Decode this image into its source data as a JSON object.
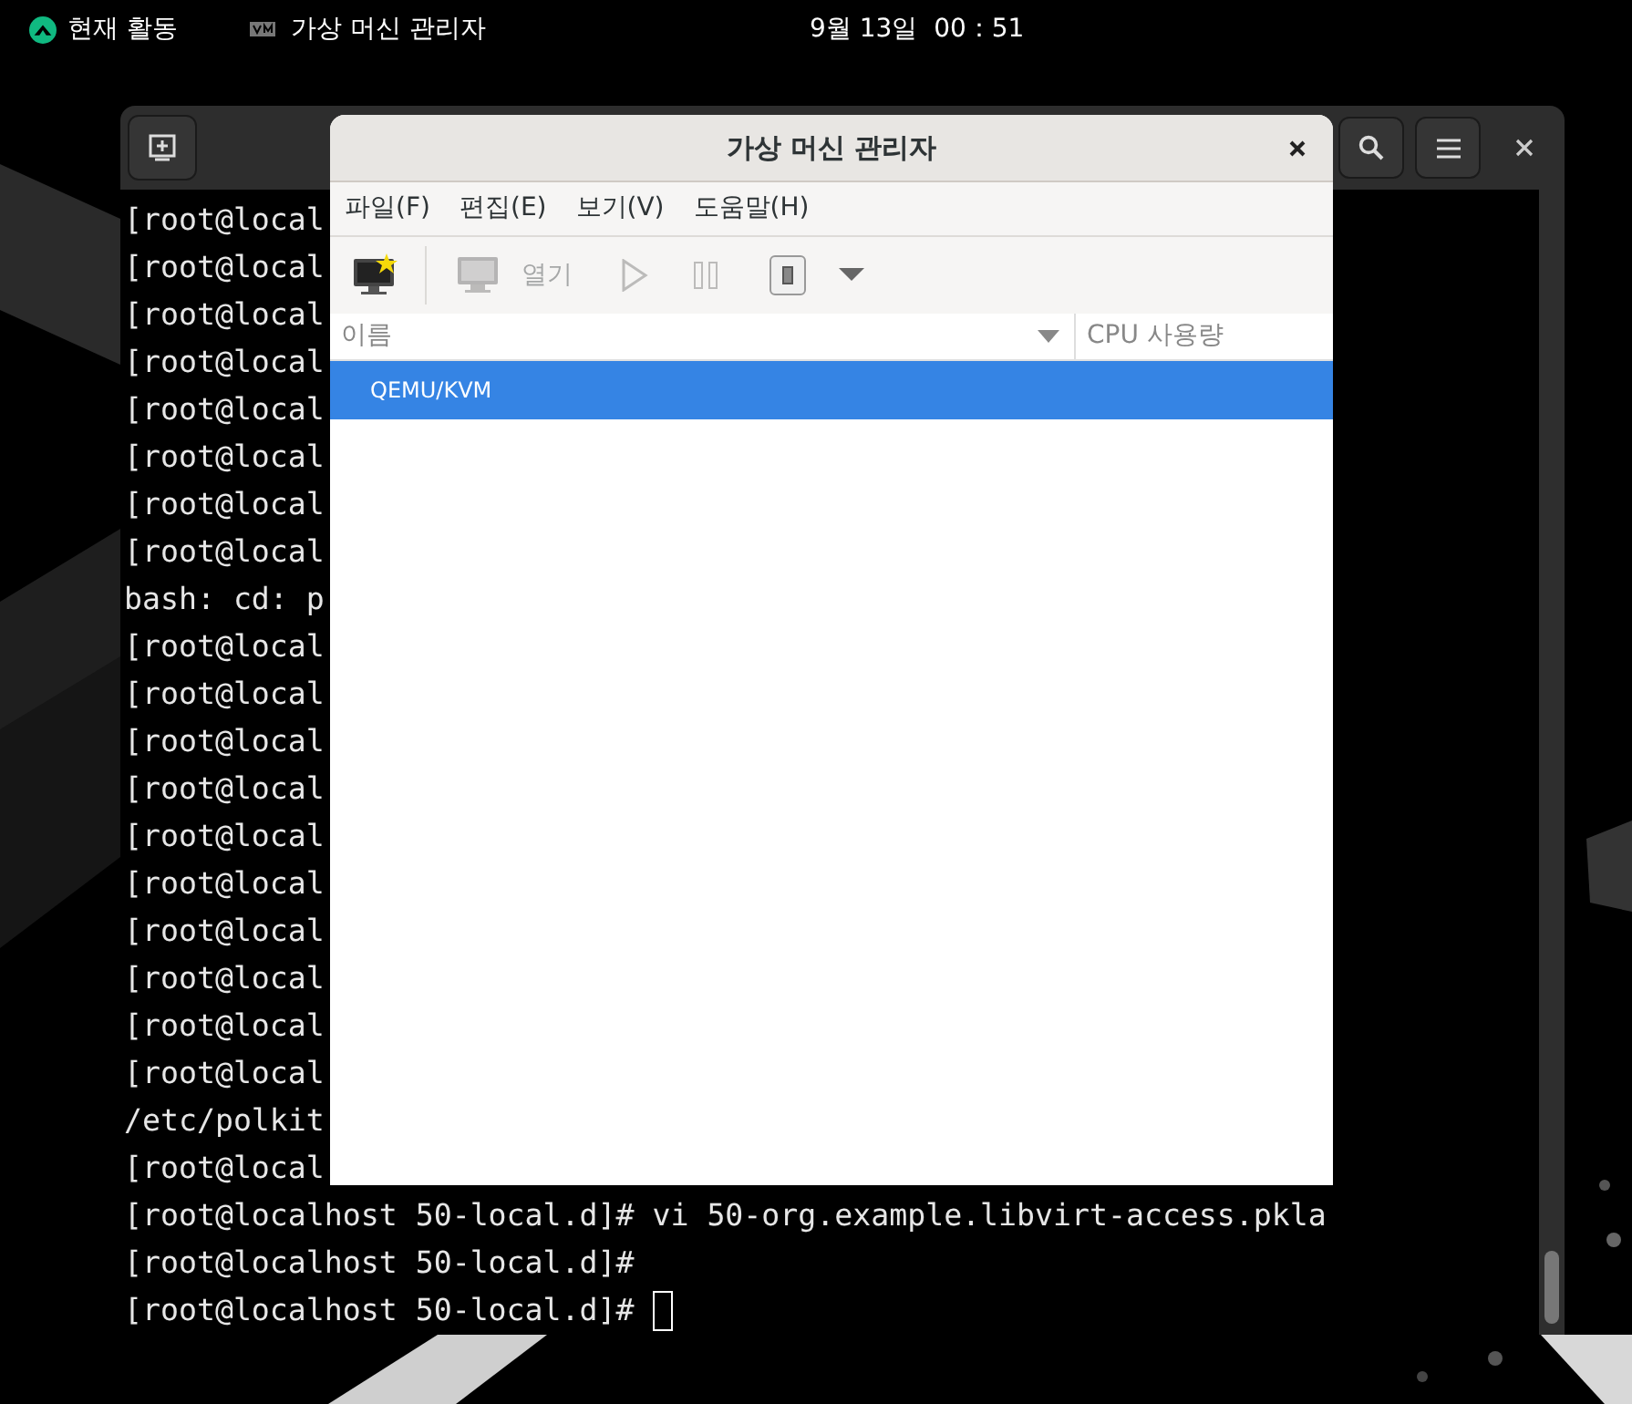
{
  "top_bar": {
    "activities": "현재 활동",
    "app_name": "가상 머신 관리자",
    "clock": "9월 13일  00：51"
  },
  "terminal": {
    "lines": [
      "[root@local",
      "[root@local",
      "[root@local",
      "[root@local",
      "[root@local",
      "[root@local",
      "[root@local",
      "[root@local",
      "bash: cd: p",
      "[root@local",
      "[root@local",
      "[root@local",
      "[root@local",
      "[root@local",
      "[root@local",
      "[root@local",
      "[root@local",
      "[root@local",
      "[root@local",
      "/etc/polkit",
      "[root@local",
      "[root@localhost 50-local.d]# vi 50-org.example.libvirt-access.pkla",
      "[root@localhost 50-local.d]#",
      "[root@localhost 50-local.d]# "
    ],
    "cursor": true
  },
  "dialog": {
    "title": "가상 머신 관리자",
    "menu": [
      "파일(F)",
      "편집(E)",
      "보기(V)",
      "도움말(H)"
    ],
    "toolbar": [
      {
        "kind": "new",
        "disabled": false
      },
      {
        "kind": "open",
        "label": "열기",
        "disabled": true
      },
      {
        "kind": "run",
        "disabled": true
      },
      {
        "kind": "pause",
        "disabled": true
      },
      {
        "kind": "stop",
        "disabled": false
      },
      {
        "kind": "dropdown",
        "disabled": false
      }
    ],
    "columns": [
      "이름",
      "CPU 사용량"
    ],
    "rows": [
      {
        "name": "QEMU/KVM",
        "selected": true
      }
    ]
  }
}
